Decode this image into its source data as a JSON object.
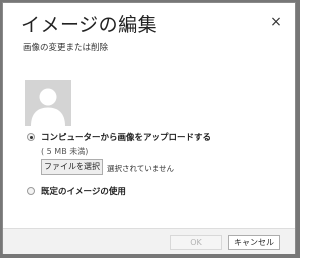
{
  "dialog": {
    "title": "イメージの編集",
    "subtitle": "画像の変更または削除",
    "close_glyph": "×"
  },
  "avatar": {
    "icon": "default-user-avatar-icon",
    "background_color": "#d4d4d4"
  },
  "options": {
    "upload": {
      "label": "コンピューターから画像をアップロードする",
      "selected": true,
      "size_hint": "( 5 MB 未満)",
      "file_button_label": "ファイルを選択",
      "file_status": "選択されていません"
    },
    "default_image": {
      "label": "既定のイメージの使用",
      "selected": false
    }
  },
  "footer": {
    "ok_label": "OK",
    "ok_enabled": false,
    "cancel_label": "キャンセル"
  }
}
